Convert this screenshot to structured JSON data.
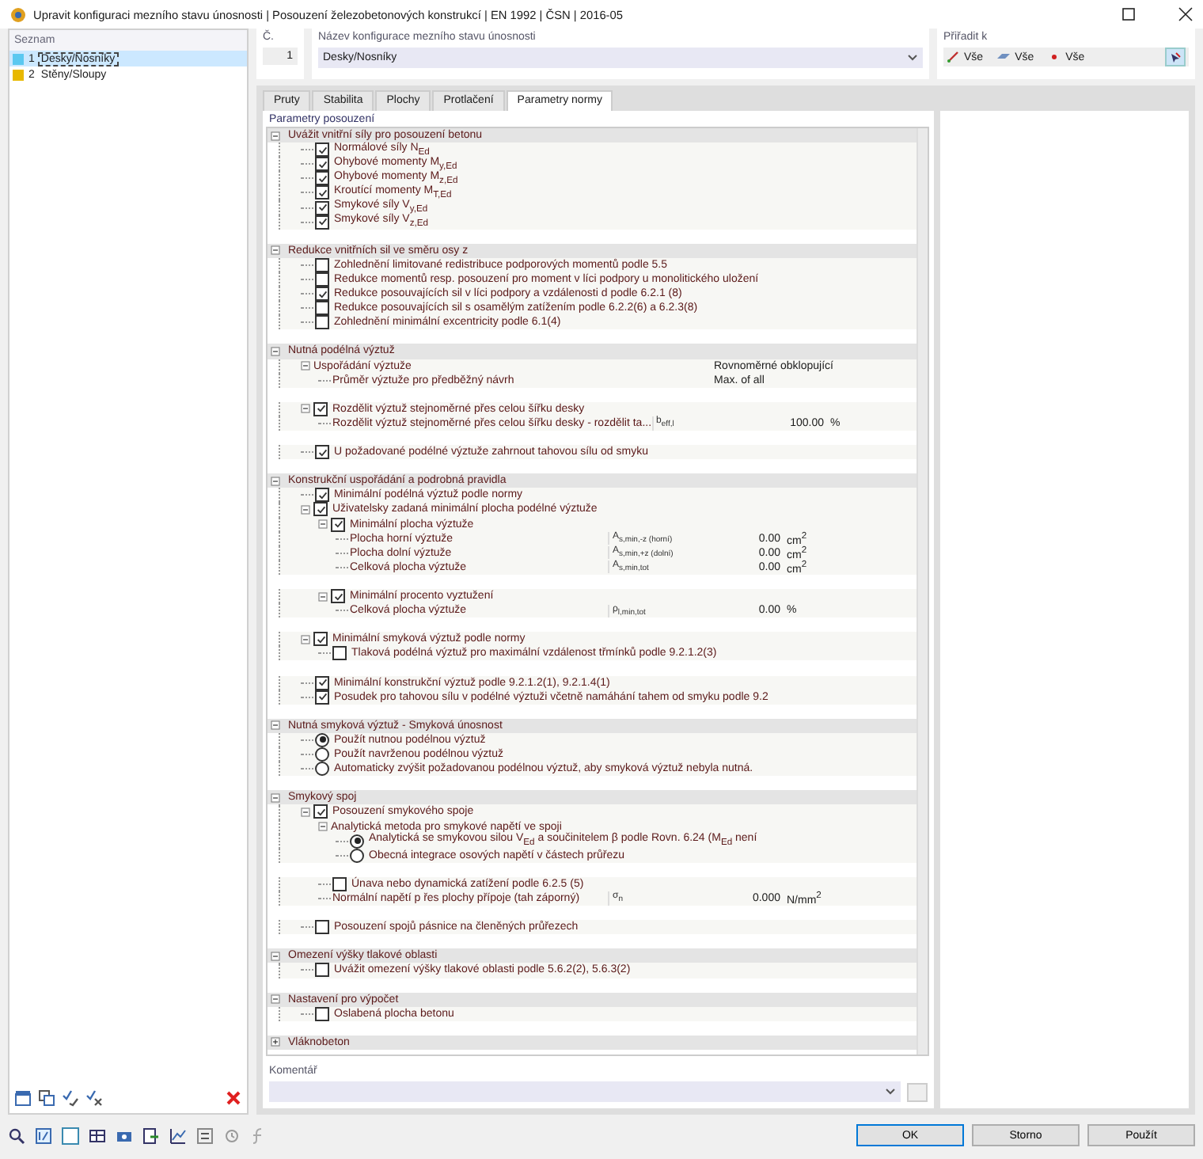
{
  "window": {
    "title": "Upravit konfiguraci mezního stavu únosnosti | Posouzení železobetonových konstrukcí | EN 1992 | ČSN | 2016-05"
  },
  "list": {
    "title": "Seznam",
    "items": [
      {
        "number": "1",
        "name": "Desky/Nosníky",
        "color": "#5bc8f0",
        "selected": true
      },
      {
        "number": "2",
        "name": "Stěny/Sloupy",
        "color": "#e8b800",
        "selected": false
      }
    ]
  },
  "number_field": {
    "label": "Č.",
    "value": "1"
  },
  "name_field": {
    "label": "Název konfigurace mezního stavu únosnosti",
    "value": "Desky/Nosníky"
  },
  "assign": {
    "label": "Přiřadit k",
    "items": [
      "Vše",
      "Vše",
      "Vše"
    ]
  },
  "tabs": [
    {
      "label": "Pruty",
      "selected": false
    },
    {
      "label": "Stabilita",
      "selected": false
    },
    {
      "label": "Plochy",
      "selected": false
    },
    {
      "label": "Protlačení",
      "selected": false
    },
    {
      "label": "Parametry normy",
      "selected": true
    }
  ],
  "group_label": "Parametry posouzení",
  "sections": [
    {
      "title": "Uvážit vnitřní síly pro posouzení betonu",
      "expanded": true,
      "items": [
        {
          "kind": "check",
          "label": "Normálové síly N$_{Ed}$",
          "checked": true
        },
        {
          "kind": "check",
          "label": "Ohybové momenty M$_{y,Ed}$",
          "checked": true
        },
        {
          "kind": "check",
          "label": "Ohybové momenty M$_{z,Ed}$",
          "checked": true
        },
        {
          "kind": "check",
          "label": "Kroutící momenty M$_{T,Ed}$",
          "checked": true
        },
        {
          "kind": "check",
          "label": "Smykové síly V$_{y,Ed}$",
          "checked": true
        },
        {
          "kind": "check",
          "label": "Smykové síly V$_{z,Ed}$",
          "checked": true
        }
      ]
    },
    {
      "title": "Redukce vnitřních sil ve směru osy z",
      "expanded": true,
      "items": [
        {
          "kind": "check",
          "label": "Zohlednění limitované redistribuce podporových momentů podle 5.5",
          "checked": false
        },
        {
          "kind": "check",
          "label": "Redukce momentů resp. posouzení pro moment v líci podpory u monolitického uložení",
          "checked": false
        },
        {
          "kind": "check",
          "label": "Redukce posouvajících sil v líci podpory a vzdálenosti d podle 6.2.1 (8)",
          "checked": true
        },
        {
          "kind": "check",
          "label": "Redukce posouvajících sil s osamělým zatížením podle 6.2.2(6) a 6.2.3(8)",
          "checked": false
        },
        {
          "kind": "check",
          "label": "Zohlednění minimální excentricity podle 6.1(4)",
          "checked": false
        }
      ]
    },
    {
      "title": "Nutná podélná výztuž",
      "expanded": true,
      "items": [
        {
          "kind": "text",
          "label": "Uspořádání výztuže",
          "value": "Rovnoměrné obklopující",
          "expanded": true,
          "children": [
            {
              "kind": "text",
              "label": "Průměr výztuže pro předběžný návrh",
              "value": "Max. of all"
            }
          ]
        },
        {
          "kind": "check",
          "label": "Rozdělit výztuž stejnoměrné přes celou šířku desky",
          "checked": true,
          "expanded": true,
          "children": [
            {
              "kind": "text",
              "label": "Rozdělit výztuž stejnoměrné přes celou šířku desky - rozdělit ta...",
              "symbol": "b$_{eff,l}$",
              "value": "100.00",
              "unit": "%"
            }
          ]
        },
        {
          "kind": "check",
          "label": "U požadované podélné výztuže zahrnout tahovou sílu od smyku",
          "checked": true
        }
      ]
    },
    {
      "title": "Konstrukční uspořádání a podrobná pravidla",
      "expanded": true,
      "items": [
        {
          "kind": "check",
          "label": "Minimální podélná výztuž podle normy",
          "checked": true
        },
        {
          "kind": "check",
          "label": "Uživatelsky zadaná minimální plocha podélné výztuže",
          "checked": true,
          "expanded": true,
          "children": [
            {
              "kind": "check",
              "label": "Minimální plocha výztuže",
              "checked": true,
              "expanded": true,
              "children": [
                {
                  "kind": "text",
                  "label": "Plocha horní výztuže",
                  "symbol": "A$_{s,min,-z (horní)}$",
                  "value": "0.00",
                  "unit": "cm$^{2}$"
                },
                {
                  "kind": "text",
                  "label": "Plocha dolní výztuže",
                  "symbol": "A$_{s,min,+z (dolní)}$",
                  "value": "0.00",
                  "unit": "cm$^{2}$"
                },
                {
                  "kind": "text",
                  "label": "Celková plocha výztuže",
                  "symbol": "A$_{s,min,tot}$",
                  "value": "0.00",
                  "unit": "cm$^{2}$"
                }
              ]
            },
            {
              "kind": "check",
              "label": "Minimální procento vyztužení",
              "checked": true,
              "expanded": true,
              "children": [
                {
                  "kind": "text",
                  "label": "Celková plocha výztuže",
                  "symbol": "ρ$_{l,min,tot}$",
                  "value": "0.00",
                  "unit": "%"
                }
              ]
            }
          ]
        },
        {
          "kind": "check",
          "label": "Minimální smyková výztuž podle normy",
          "checked": true,
          "expanded": true,
          "children": [
            {
              "kind": "check",
              "label": "Tlaková podélná výztuž pro maximální vzdálenost třmínků podle 9.2.1.2(3)",
              "checked": false
            }
          ]
        },
        {
          "kind": "check",
          "label": "Minimální konstrukční výztuž podle 9.2.1.2(1), 9.2.1.4(1)",
          "checked": true
        },
        {
          "kind": "check",
          "label": "Posudek pro tahovou sílu v podélné výztuži včetně namáhání tahem od smyku podle 9.2",
          "checked": true
        }
      ]
    },
    {
      "title": "Nutná smyková výztuž - Smyková únosnost",
      "expanded": true,
      "items": [
        {
          "kind": "radio",
          "label": "Použít nutnou podélnou výztuž",
          "selected": true
        },
        {
          "kind": "radio",
          "label": "Použít navrženou podélnou výztuž",
          "selected": false
        },
        {
          "kind": "radio",
          "label": "Automaticky zvýšit požadovanou podélnou výztuž, aby smyková výztuž nebyla nutná.",
          "selected": false
        }
      ]
    },
    {
      "title": "Smykový spoj",
      "expanded": true,
      "items": [
        {
          "kind": "check",
          "label": "Posouzení smykového spoje",
          "checked": true,
          "expanded": true,
          "children": [
            {
              "kind": "text",
              "label": "Analytická metoda pro smykové napětí ve spoji",
              "expanded": true,
              "children": [
                {
                  "kind": "radio",
                  "label": "Analytická se smykovou silou V$_{Ed}$ a součinitelem β podle Rovn. 6.24 (M$_{Ed}$ není",
                  "selected": true
                },
                {
                  "kind": "radio",
                  "label": "Obecná integrace osových napětí v částech průřezu",
                  "selected": false
                }
              ]
            },
            {
              "kind": "check",
              "label": "Únava nebo dynamická zatížení podle 6.2.5 (5)",
              "checked": false
            },
            {
              "kind": "text",
              "label": "Normální napětí p řes plochy přípoje (tah záporný)",
              "symbol": "σ$_{n}$",
              "value": "0.000",
              "unit": "N/mm$^{2}$"
            }
          ]
        },
        {
          "kind": "check",
          "label": "Posouzení spojů pásnice na členěných průřezech",
          "checked": false
        }
      ]
    },
    {
      "title": "Omezení výšky tlakové oblasti",
      "expanded": true,
      "items": [
        {
          "kind": "check",
          "label": "Uvážit omezení výšky tlakové oblasti podle 5.6.2(2), 5.6.3(2)",
          "checked": false
        }
      ]
    },
    {
      "title": "Nastavení pro výpočet",
      "expanded": true,
      "items": [
        {
          "kind": "check",
          "label": "Oslabená plocha betonu",
          "checked": false
        }
      ]
    },
    {
      "title": "Vláknobeton",
      "expanded": false
    }
  ],
  "comment": {
    "label": "Komentář"
  },
  "buttons": [
    {
      "label": "OK",
      "default": true
    },
    {
      "label": "Storno",
      "default": false
    },
    {
      "label": "Použít",
      "default": false
    }
  ]
}
